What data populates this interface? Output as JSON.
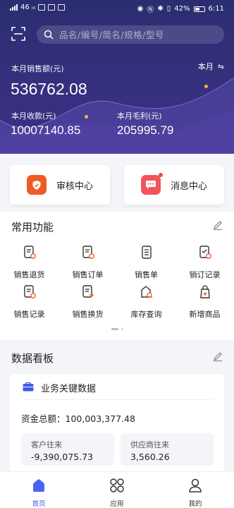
{
  "status_bar": {
    "left": "46 ᵢᵢₗ",
    "battery": "42%",
    "time": "6:11"
  },
  "search": {
    "placeholder": "品名/编号/简名/规格/型号"
  },
  "sales": {
    "title": "本月销售额(元)",
    "value": "536762.08",
    "period": "本月",
    "received_label": "本月收款(元)",
    "received_value": "10007140.85",
    "profit_label": "本月毛利(元)",
    "profit_value": "205995.79"
  },
  "quick_cards": {
    "audit": "审核中心",
    "messages": "消息中心"
  },
  "common": {
    "title": "常用功能",
    "items": [
      {
        "label": "销售退货",
        "icon": "sales-return-icon"
      },
      {
        "label": "销售订单",
        "icon": "sales-order-icon"
      },
      {
        "label": "销售单",
        "icon": "sales-doc-icon"
      },
      {
        "label": "销订记录",
        "icon": "order-record-icon"
      },
      {
        "label": "销售记录",
        "icon": "sales-record-icon"
      },
      {
        "label": "销售换货",
        "icon": "sales-exchange-icon"
      },
      {
        "label": "库存查询",
        "icon": "inventory-search-icon"
      },
      {
        "label": "新增商品",
        "icon": "add-product-icon"
      }
    ]
  },
  "dashboard": {
    "title": "数据看板",
    "card_title": "业务关键数据",
    "total_label": "资金总额：",
    "total_value": "100,003,377.48",
    "customer_label": "客户往来",
    "customer_value": "-9,390,075.73",
    "supplier_label": "供应商往来",
    "supplier_value": "3,560.26"
  },
  "tabs": [
    {
      "label": "首页",
      "active": true
    },
    {
      "label": "应用",
      "active": false
    },
    {
      "label": "我的",
      "active": false
    }
  ],
  "colors": {
    "hero": "#2f2e78",
    "accent": "#3d5af1",
    "orange": "#f05a24",
    "red": "#f04a3e"
  }
}
